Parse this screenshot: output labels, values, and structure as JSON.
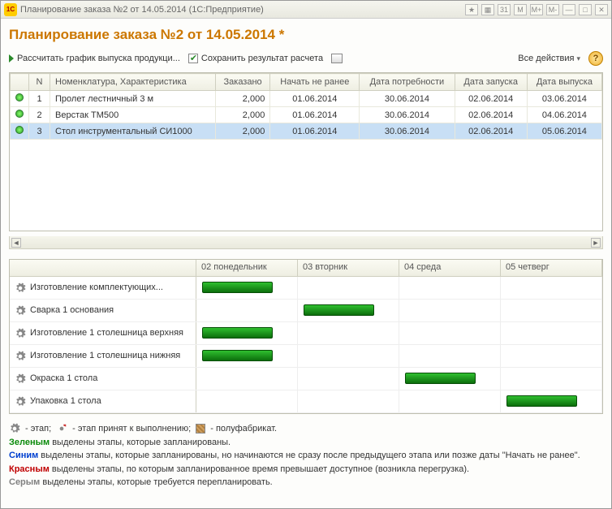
{
  "window": {
    "title": "Планирование заказа №2 от 14.05.2014  (1С:Предприятие)"
  },
  "header": {
    "page_title": "Планирование заказа №2 от 14.05.2014 *"
  },
  "toolbar": {
    "calc_label": "Рассчитать график выпуска продукци...",
    "save_label": "Сохранить результат расчета",
    "all_actions": "Все действия"
  },
  "table": {
    "columns": {
      "n": "N",
      "nomen": "Номенклатура, Характеристика",
      "ordered": "Заказано",
      "not_before": "Начать не ранее",
      "need_date": "Дата потребности",
      "start_date": "Дата запуска",
      "release_date": "Дата выпуска"
    },
    "rows": [
      {
        "n": "1",
        "name": "Пролет лестничный 3 м",
        "ordered": "2,000",
        "not_before": "01.06.2014",
        "need": "30.06.2014",
        "start": "02.06.2014",
        "release": "03.06.2014"
      },
      {
        "n": "2",
        "name": "Верстак ТМ500",
        "ordered": "2,000",
        "not_before": "01.06.2014",
        "need": "30.06.2014",
        "start": "02.06.2014",
        "release": "04.06.2014"
      },
      {
        "n": "3",
        "name": "Стол инструментальный СИ1000",
        "ordered": "2,000",
        "not_before": "01.06.2014",
        "need": "30.06.2014",
        "start": "02.06.2014",
        "release": "05.06.2014",
        "selected": true
      }
    ]
  },
  "gantt": {
    "days": [
      "02 понедельник",
      "03 вторник",
      "04 среда",
      "05 четверг"
    ],
    "tasks": [
      {
        "name": "Изготовление  комплектующих...",
        "bar_day": 0
      },
      {
        "name": "Сварка 1 основания",
        "bar_day": 1
      },
      {
        "name": "Изготовление 1 столешница верхняя",
        "bar_day": 0
      },
      {
        "name": "Изготовление 1 столешница нижняя",
        "bar_day": 0
      },
      {
        "name": "Окраска 1 стола",
        "bar_day": 2
      },
      {
        "name": "Упаковка 1 стола",
        "bar_day": 3
      }
    ]
  },
  "legend": {
    "stage": "- этап;",
    "stage_accepted": "- этап принят к выполнению;",
    "semi": "- полуфабрикат.",
    "green_lbl": "Зеленым",
    "green_txt": " выделены этапы, которые запланированы.",
    "blue_lbl": "Синим",
    "blue_txt": " выделены этапы, которые запланированы, но начинаются не сразу после предыдущего этапа или позже даты \"Начать не ранее\".",
    "red_lbl": "Красным",
    "red_txt": " выделены этапы, по которым запланированное время превышает доступное (возникла перегрузка).",
    "gray_lbl": "Серым",
    "gray_txt": " выделены этапы, которые требуется перепланировать."
  },
  "chart_data": {
    "type": "gantt",
    "x_categories": [
      "02 понедельник",
      "03 вторник",
      "04 среда",
      "05 четверг"
    ],
    "tasks": [
      {
        "name": "Изготовление комплектующих...",
        "start_index": 0,
        "duration_days": 1
      },
      {
        "name": "Сварка 1 основания",
        "start_index": 1,
        "duration_days": 1
      },
      {
        "name": "Изготовление 1 столешница верхняя",
        "start_index": 0,
        "duration_days": 1
      },
      {
        "name": "Изготовление 1 столешница нижняя",
        "start_index": 0,
        "duration_days": 1
      },
      {
        "name": "Окраска 1 стола",
        "start_index": 2,
        "duration_days": 1
      },
      {
        "name": "Упаковка 1 стола",
        "start_index": 3,
        "duration_days": 1
      }
    ],
    "dependencies": [
      [
        0,
        1
      ],
      [
        2,
        1
      ],
      [
        3,
        1
      ],
      [
        1,
        4
      ],
      [
        4,
        5
      ]
    ]
  }
}
